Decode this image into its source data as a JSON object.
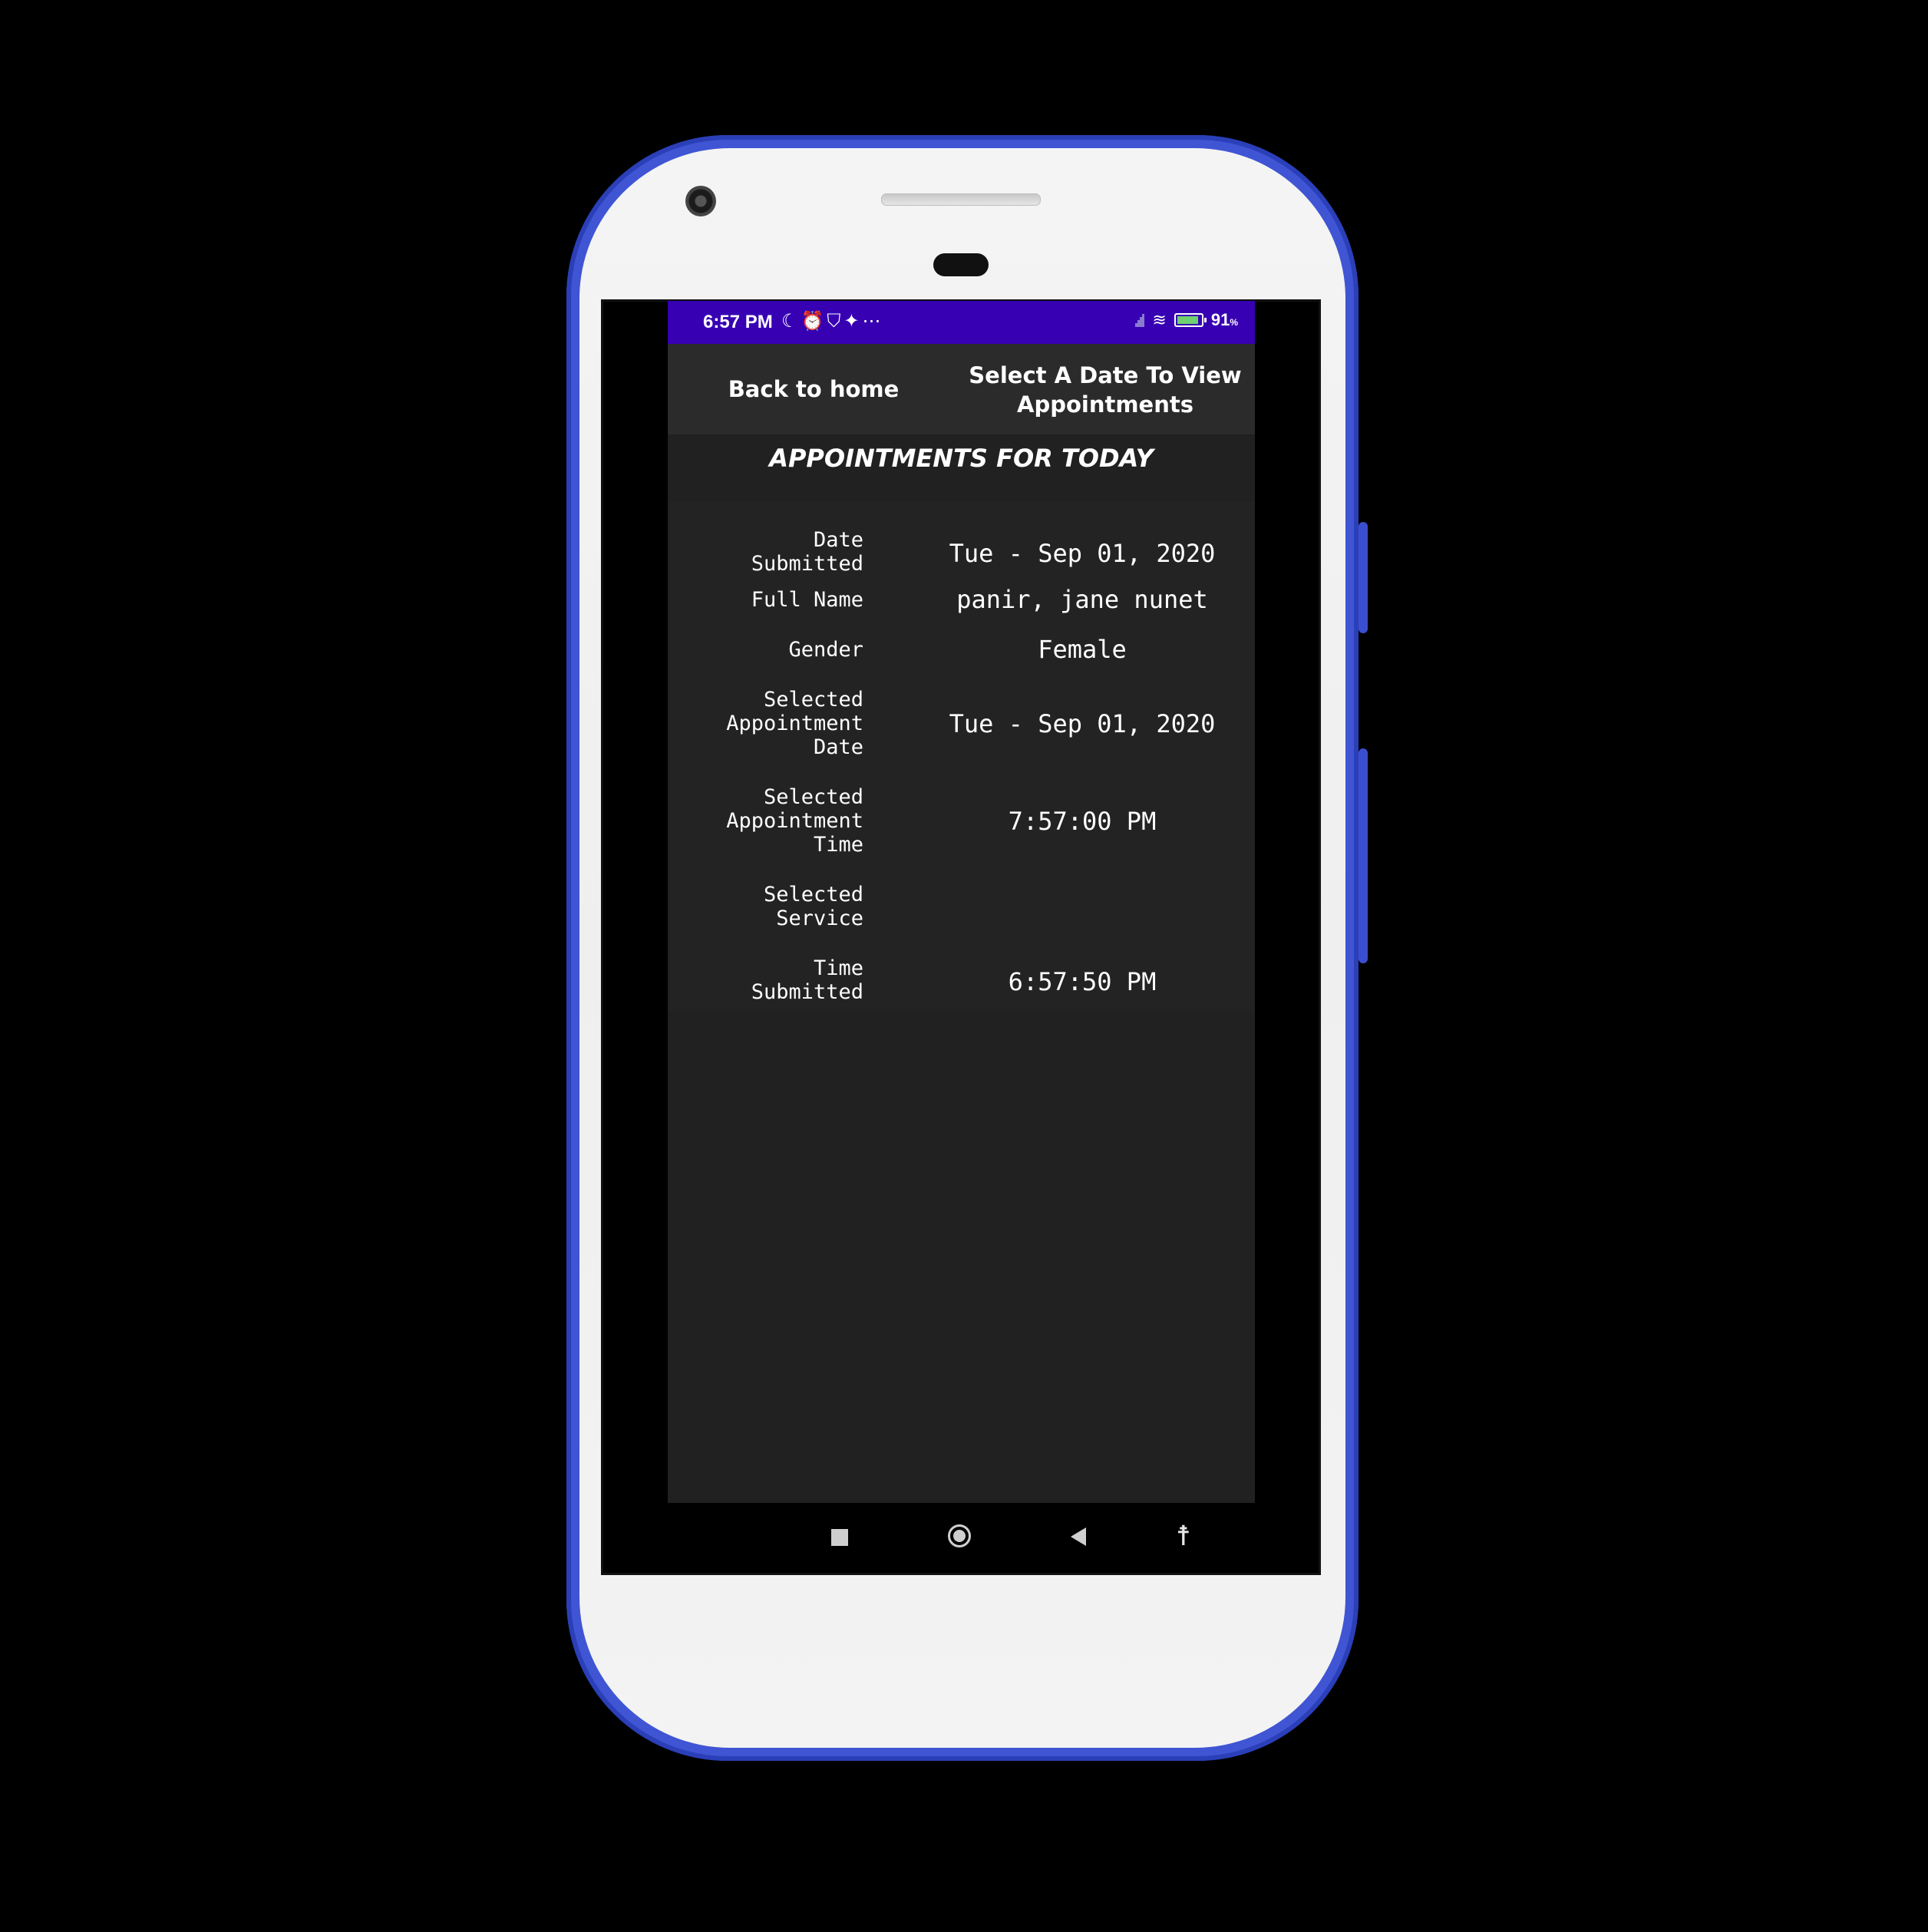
{
  "status_bar": {
    "time": "6:57 PM",
    "left_icons": [
      "moon-icon",
      "alarm-icon",
      "shield-icon",
      "twitter-icon",
      "more-dots-icon"
    ],
    "right_icons": [
      "signal-icon",
      "wifi-icon",
      "battery-charging-icon"
    ],
    "battery_level": "91",
    "battery_unit": "%"
  },
  "toolbar": {
    "back_label": "Back to home",
    "select_label": "Select A Date To View Appointments"
  },
  "heading": "APPOINTMENTS FOR TODAY",
  "details": {
    "rows": [
      {
        "label": "Date\nSubmitted",
        "value": "Tue - Sep 01, 2020"
      },
      {
        "label": "Full Name",
        "value": "panir, jane nunet"
      },
      {
        "label": "Gender",
        "value": "Female"
      },
      {
        "label": "Selected\nAppointment\nDate",
        "value": "Tue - Sep 01, 2020"
      },
      {
        "label": "Selected\nAppointment\nTime",
        "value": "7:57:00 PM"
      },
      {
        "label": "Selected\nService",
        "value": ""
      },
      {
        "label": "Time\nSubmitted",
        "value": "6:57:50 PM"
      }
    ]
  },
  "colors": {
    "status_bar": "#3700b3",
    "app_background": "#212121",
    "toolbar_background": "#2b2b2b",
    "phone_frame": "#3f55d4"
  },
  "navbar": {
    "icons": [
      "recents-square-icon",
      "home-circle-icon",
      "back-triangle-icon",
      "accessibility-icon"
    ]
  }
}
